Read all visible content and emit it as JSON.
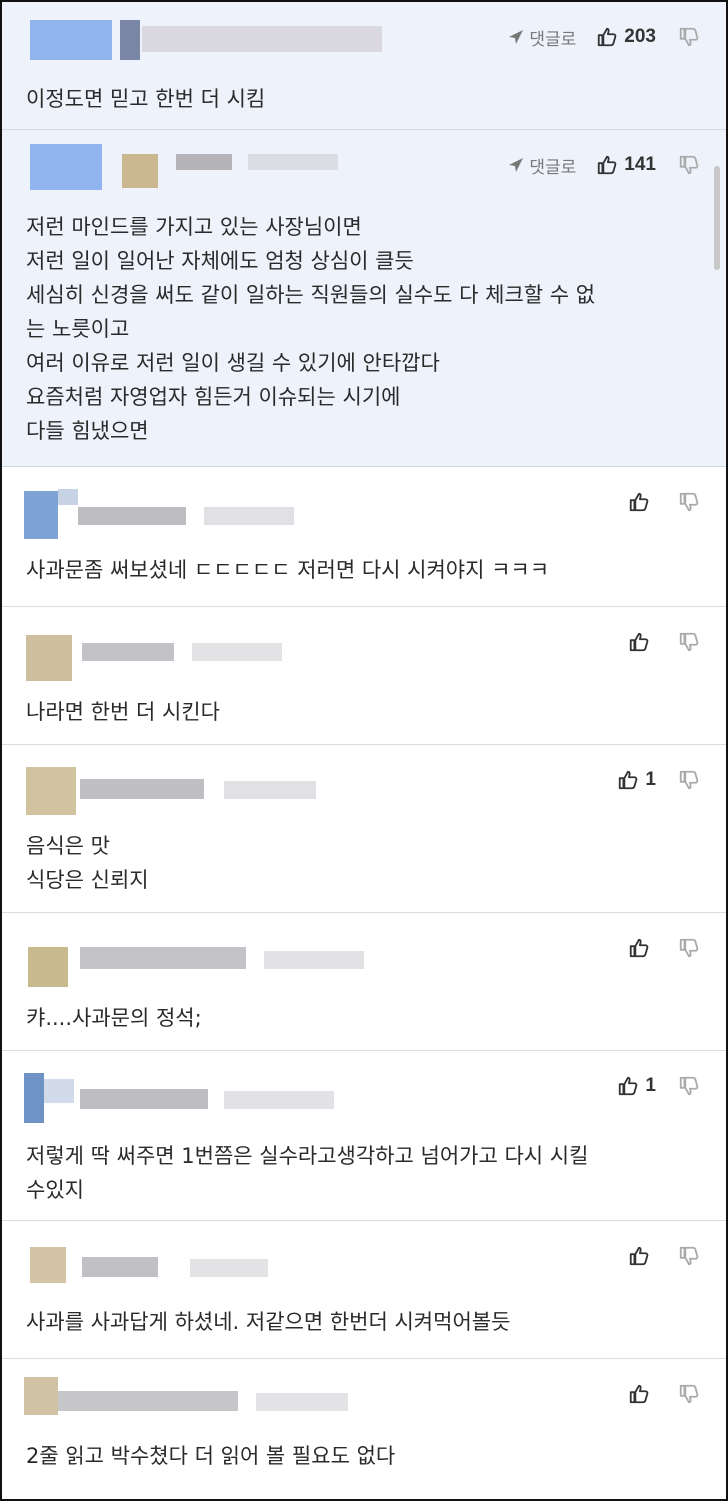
{
  "labels": {
    "reply": "댓글로"
  },
  "colors": {
    "highlight_bg": "#eef3fb",
    "border": "#dcdcdc",
    "text": "#2a2a2a"
  },
  "comments": [
    {
      "text": "이정도면 믿고 한번 더 시킴",
      "likes": "203",
      "has_reply": true,
      "highlight": true
    },
    {
      "text": "저런 마인드를 가지고 있는 사장님이면\n저런 일이 일어난 자체에도 엄청 상심이 클듯\n세심히 신경을 써도 같이 일하는 직원들의 실수도 다 체크할 수 없\n는 노릇이고\n여러 이유로 저런 일이 생길 수 있기에 안타깝다\n요즘처럼 자영업자 힘든거 이슈되는 시기에\n다들 힘냈으면",
      "likes": "141",
      "has_reply": true,
      "highlight": true
    },
    {
      "text": "사과문좀 써보셨네 ㄷㄷㄷㄷㄷ 저러면 다시 시켜야지 ㅋㅋㅋ",
      "likes": "",
      "has_reply": false,
      "highlight": false
    },
    {
      "text": "나라면 한번 더 시킨다",
      "likes": "",
      "has_reply": false,
      "highlight": false
    },
    {
      "text": "음식은 맛\n식당은 신뢰지",
      "likes": "1",
      "has_reply": false,
      "highlight": false
    },
    {
      "text": "캬....사과문의 정석;",
      "likes": "",
      "has_reply": false,
      "highlight": false
    },
    {
      "text": "저렇게 딱 써주면 1번쯤은 실수라고생각하고 넘어가고 다시 시킬\n수있지",
      "likes": "1",
      "has_reply": false,
      "highlight": false
    },
    {
      "text": "사과를 사과답게 하셨네. 저같으면 한번더 시켜먹어볼듯",
      "likes": "",
      "has_reply": false,
      "highlight": false
    },
    {
      "text": "2줄 읽고 박수쳤다 더 읽어 볼 필요도 없다",
      "likes": "",
      "has_reply": false,
      "highlight": false
    }
  ]
}
